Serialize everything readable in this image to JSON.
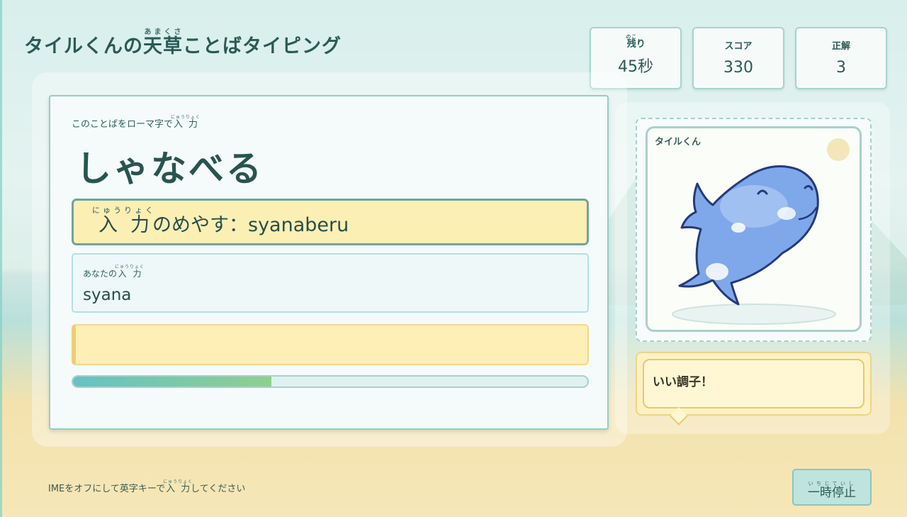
{
  "title": {
    "before": "タイルくんの",
    "kanji": "天草",
    "reading": "あまくさ",
    "after": "ことばタイピング"
  },
  "stats": {
    "time": {
      "kanji": "残",
      "reading": "のこ",
      "suffix": "り",
      "value": "45秒"
    },
    "score": {
      "label": "スコア",
      "value": "330"
    },
    "correct": {
      "label": "正解",
      "value": "3"
    }
  },
  "prompt": {
    "instruction_before": "このことばをローマ字で",
    "instruction_kanji": "入力",
    "instruction_reading": "にゅうりょく",
    "word": "しゃなべる"
  },
  "guide": {
    "kanji": "入力",
    "reading": "にゅうりょく",
    "rest": "のめやす：",
    "romaji": "syanaberu"
  },
  "answer": {
    "label_before": "あなたの",
    "label_kanji": "入力",
    "label_reading": "にゅうりょく",
    "typed": "syana"
  },
  "progress": {
    "fraction": 0.385
  },
  "character": {
    "name": "タイルくん",
    "icon": "dolphin-mascot"
  },
  "speech": {
    "text": "いい調子！"
  },
  "footer": {
    "hint_before": "IMEをオフにして英字キーで",
    "hint_kanji": "入力",
    "hint_reading": "にゅうりょく",
    "hint_after": "してください",
    "pause_label": "一時停止",
    "pause_reading": "いちじていし"
  },
  "colors": {
    "accent": "#66c2c4",
    "sand": "#f6e7b8",
    "panel_border": "#9bcbc4",
    "highlight": "#fcefb4"
  }
}
